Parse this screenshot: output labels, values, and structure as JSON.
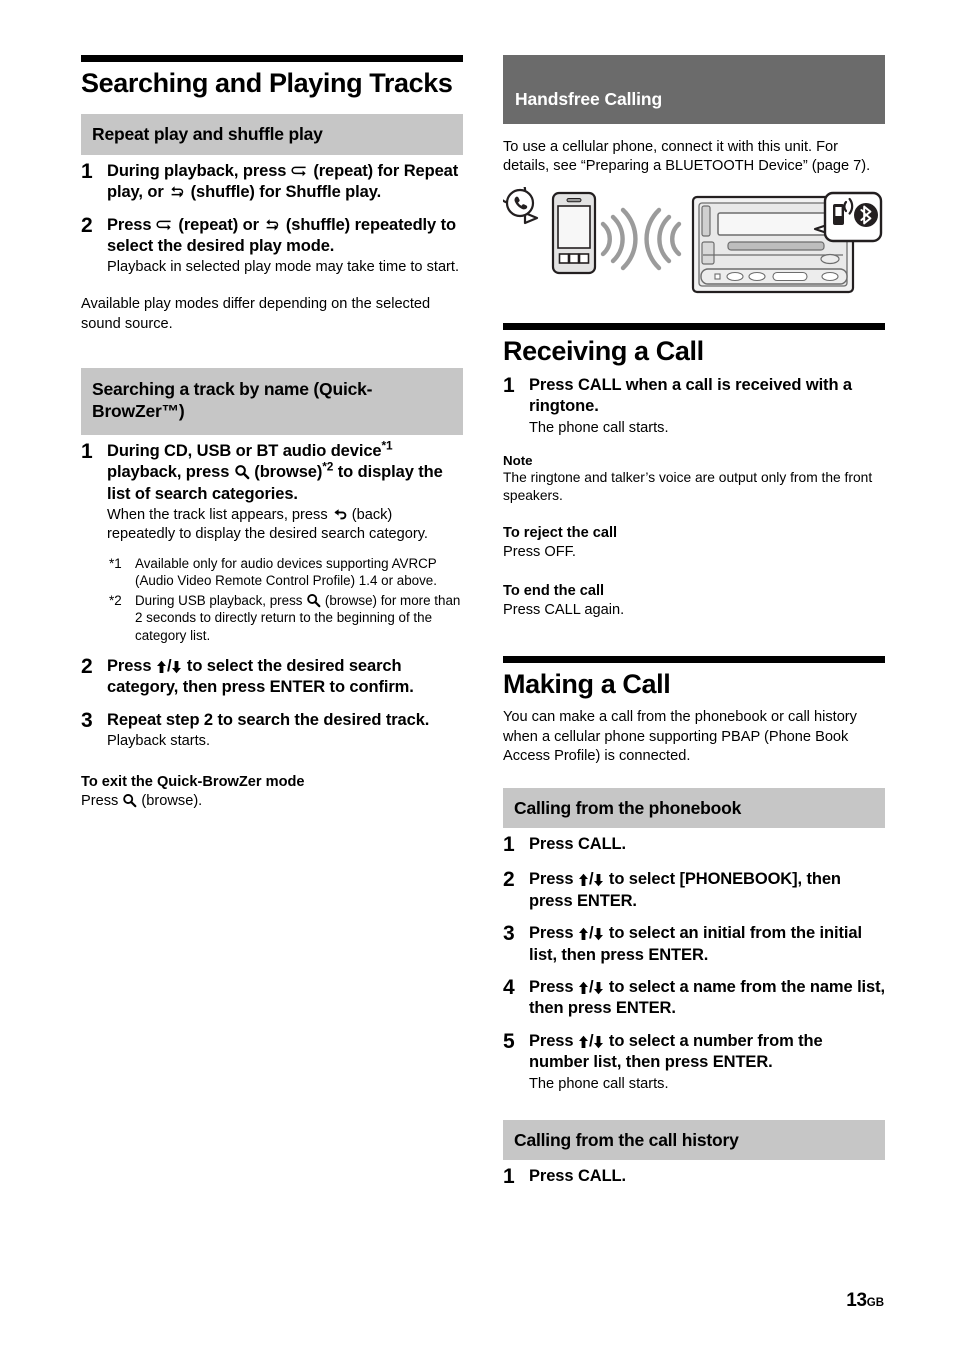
{
  "page": {
    "number": "13",
    "region_code": "GB"
  },
  "left_column": {
    "chapter_title": "Searching and Playing Tracks",
    "section_repeat": {
      "heading": "Repeat play and shuffle play",
      "steps": [
        {
          "num": "1",
          "main_before": "During playback, press ",
          "main_icon1": "repeat-icon",
          "main_mid": " (repeat) for Repeat play, or ",
          "main_icon2": "shuffle-icon",
          "main_after": " (shuffle) for Shuffle play.",
          "sub": ""
        },
        {
          "num": "2",
          "main_before": "Press ",
          "main_icon1": "repeat-icon",
          "main_mid": " (repeat) or ",
          "main_icon2": "shuffle-icon",
          "main_after": " (shuffle) repeatedly to select the desired play mode.",
          "sub": "Playback in selected play mode may take time to start."
        }
      ],
      "trailing_paragraph": "Available play modes differ depending on the selected sound source."
    },
    "section_quickbrowzer": {
      "heading": "Searching a track by name (Quick-BrowZer™)",
      "step1": {
        "num": "1",
        "main_a": "During CD, USB or BT audio device",
        "main_sup1": "*1",
        "main_b": " playback, press ",
        "main_icon": "browse-icon",
        "main_c": " (browse)",
        "main_sup2": "*2",
        "main_d": " to display the list of search categories.",
        "sub_a": "When the track list appears, press ",
        "sub_icon": "back-icon",
        "sub_b": " (back) repeatedly to display the desired search category."
      },
      "footnotes": [
        {
          "mark": "*1",
          "text": "Available only for audio devices supporting AVRCP (Audio Video Remote Control Profile) 1.4 or above."
        },
        {
          "mark": "*2",
          "text_a": "During USB playback, press ",
          "icon": "browse-icon",
          "text_b": " (browse) for more than 2 seconds to directly return to the beginning of the category list."
        }
      ],
      "step2": {
        "num": "2",
        "main_a": "Press ",
        "icon_up": "arrow-up-icon",
        "slash": "/",
        "icon_down": "arrow-down-icon",
        "main_b": " to select the desired search category, then press ENTER to confirm."
      },
      "step3": {
        "num": "3",
        "main": "Repeat step 2 to search the desired track.",
        "sub": "Playback starts."
      },
      "exit": {
        "heading": "To exit the Quick-BrowZer mode",
        "text_a": "Press ",
        "icon": "browse-icon",
        "text_b": " (browse)."
      }
    }
  },
  "right_column": {
    "handsfree_band": "Handsfree Calling",
    "handsfree_intro": "To use a cellular phone, connect it with this unit. For details, see “Preparing a BLUETOOTH Device” (page 7).",
    "figure": {
      "name": "bluetooth-pairing-illustration",
      "phone_bubble_icon": "phone-handset-icon",
      "smartphone_icon": "smartphone-icon",
      "wave_left_icon": "signal-waves-icon",
      "wave_right_icon": "signal-waves-icon",
      "head_unit_icon": "car-stereo-unit-icon",
      "callout_handset_icon": "handset-signal-icon",
      "callout_bluetooth_icon": "bluetooth-icon"
    },
    "receiving": {
      "title": "Receiving a Call",
      "step1": {
        "num": "1",
        "main": "Press CALL when a call is received with a ringtone.",
        "sub": "The phone call starts."
      },
      "note_head": "Note",
      "note_text": "The ringtone and talker’s voice are output only from the front speakers.",
      "reject_head": "To reject the call",
      "reject_text": "Press OFF.",
      "end_head": "To end the call",
      "end_text": "Press CALL again."
    },
    "making": {
      "title": "Making a Call",
      "intro": "You can make a call from the phonebook or call history when a cellular phone supporting PBAP (Phone Book Access Profile) is connected.",
      "phonebook": {
        "heading": "Calling from the phonebook",
        "steps": [
          {
            "num": "1",
            "main": "Press CALL.",
            "sub": ""
          },
          {
            "num": "2",
            "main_a": "Press ",
            "main_b": " to select [PHONEBOOK], then press ENTER.",
            "sub": ""
          },
          {
            "num": "3",
            "main_a": "Press ",
            "main_b": " to select an initial from the initial list, then press ENTER.",
            "sub": ""
          },
          {
            "num": "4",
            "main_a": "Press ",
            "main_b": " to select a name from the name list, then press ENTER.",
            "sub": ""
          },
          {
            "num": "5",
            "main_a": "Press ",
            "main_b": " to select a number from the number list, then press ENTER.",
            "sub": "The phone call starts."
          }
        ]
      },
      "call_history": {
        "heading": "Calling from the call history",
        "steps": [
          {
            "num": "1",
            "main": "Press CALL.",
            "sub": ""
          }
        ]
      }
    }
  },
  "colors": {
    "band_dark": "#6b6b6b",
    "band_light": "#c6c6c6",
    "rule": "#000000",
    "text": "#000000"
  }
}
